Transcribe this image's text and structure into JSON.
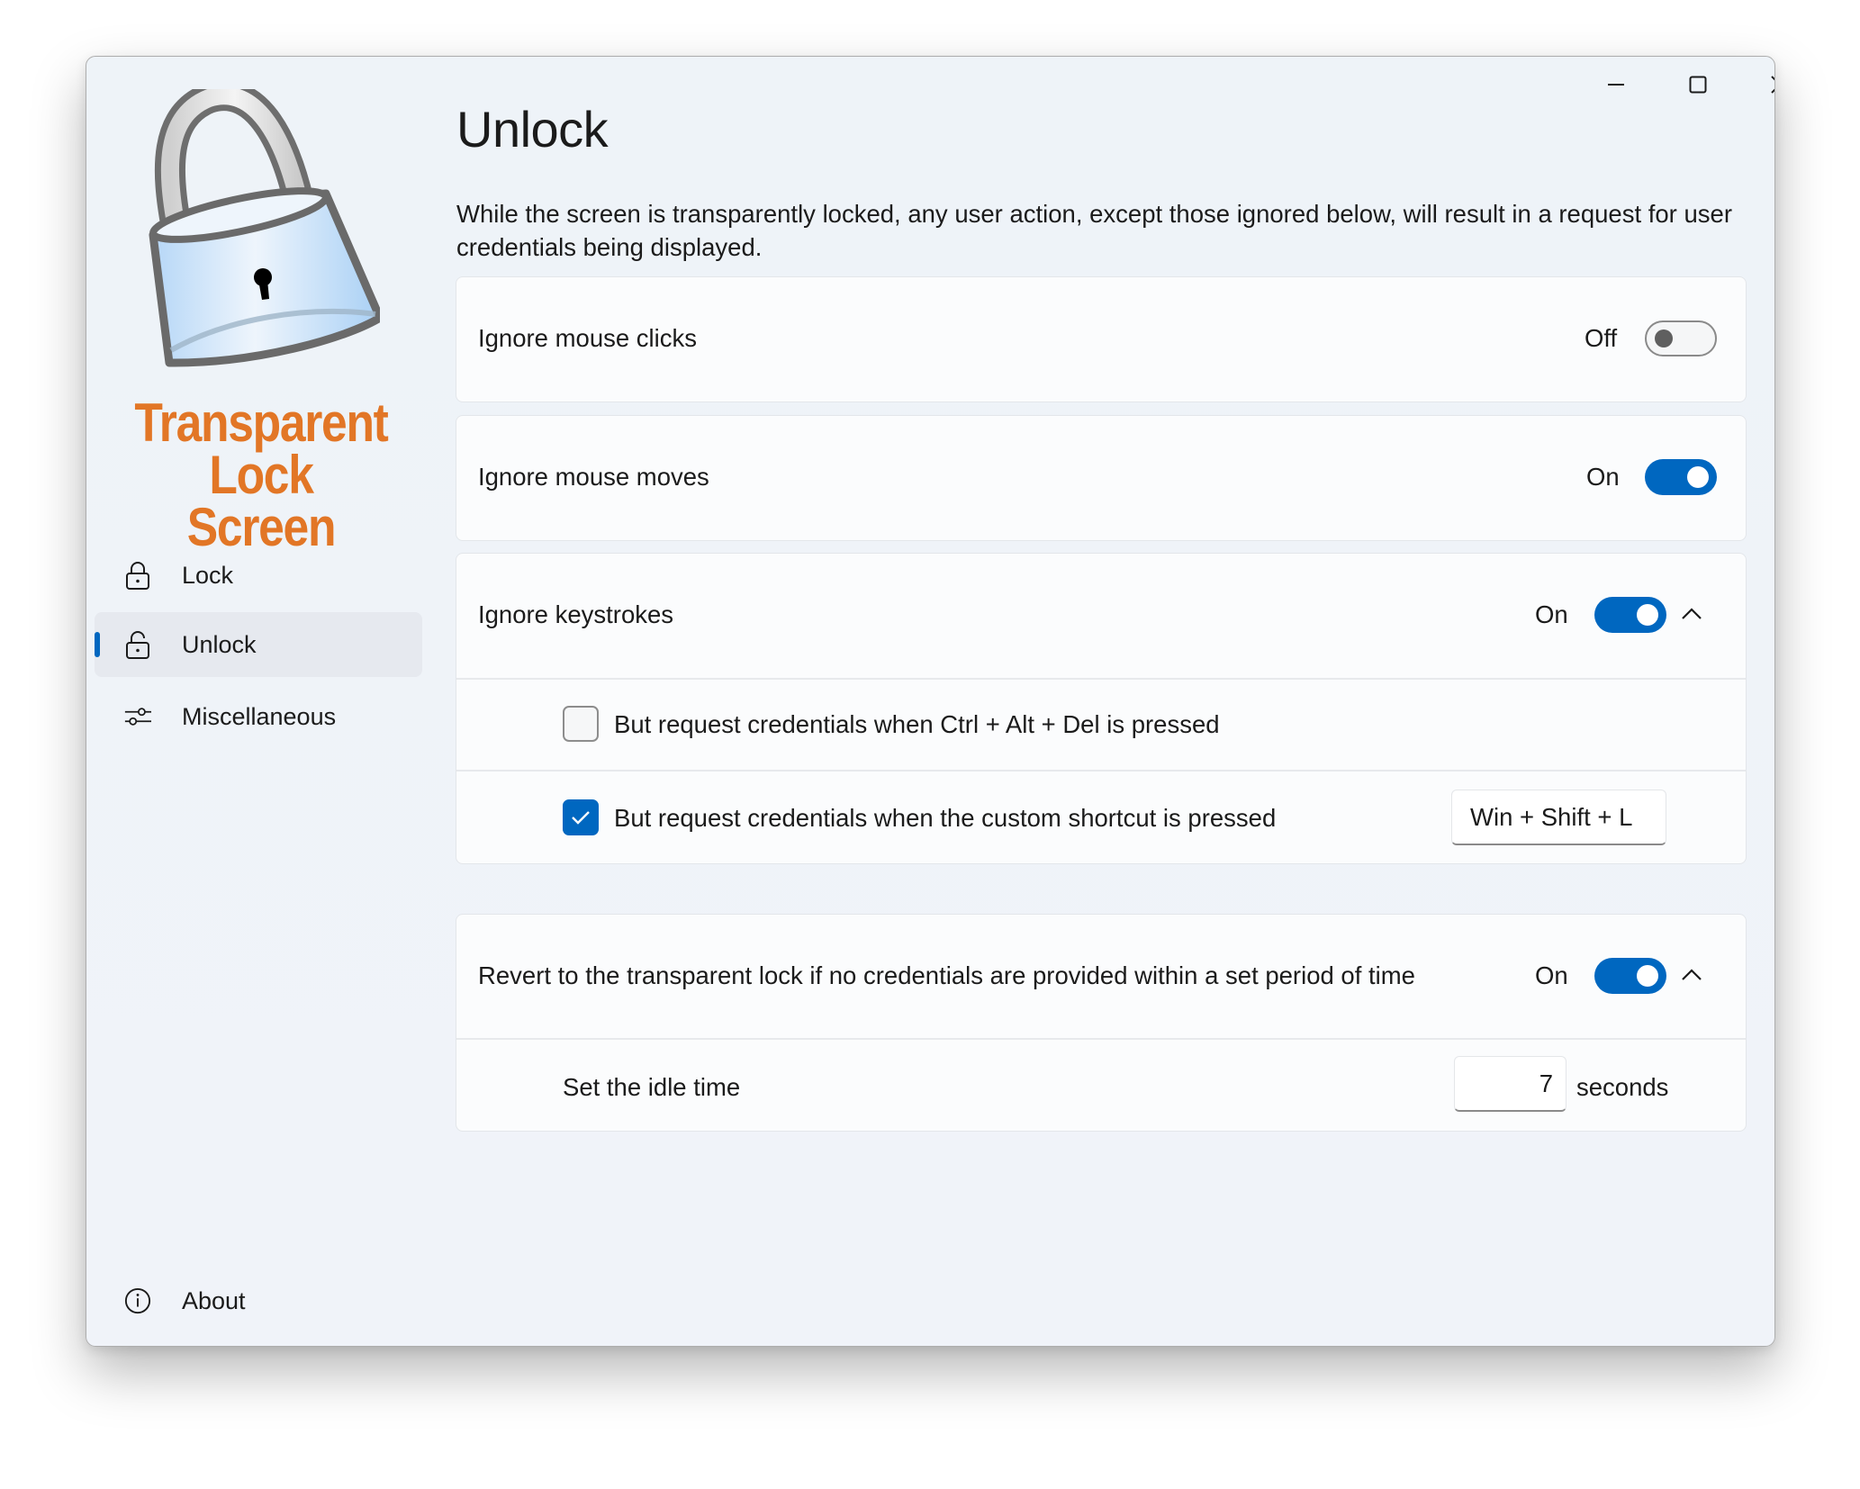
{
  "window": {
    "caption_buttons": [
      {
        "name": "minimize",
        "icon": "minimize-icon"
      },
      {
        "name": "maximize",
        "icon": "maximize-icon"
      },
      {
        "name": "close",
        "icon": "close-icon"
      }
    ]
  },
  "app": {
    "logo_line1": "Transparent",
    "logo_line2": "Lock Screen",
    "logo_icon": "padlock-icon",
    "brand_color": "#e27626"
  },
  "sidebar": {
    "items": [
      {
        "label": "Lock",
        "icon": "lock-icon",
        "selected": false
      },
      {
        "label": "Unlock",
        "icon": "unlock-icon",
        "selected": true
      },
      {
        "label": "Miscellaneous",
        "icon": "sliders-icon",
        "selected": false
      }
    ],
    "footer": {
      "label": "About",
      "icon": "info-icon"
    }
  },
  "page": {
    "title": "Unlock",
    "description": "While the screen is transparently locked, any user action, except those ignored below, will result in a request for user credentials being displayed.",
    "accent_color": "#0067c0",
    "settings": {
      "mouse_clicks": {
        "label": "Ignore mouse clicks",
        "state_text": "Off",
        "on": false
      },
      "mouse_moves": {
        "label": "Ignore mouse moves",
        "state_text": "On",
        "on": true
      },
      "keystrokes": {
        "label": "Ignore keystrokes",
        "state_text": "On",
        "on": true,
        "expanded": true,
        "options": [
          {
            "label": "But request credentials when Ctrl + Alt + Del is pressed",
            "checked": false
          },
          {
            "label": "But request credentials when the custom shortcut is pressed",
            "checked": true,
            "shortcut": "Win + Shift + L"
          }
        ]
      },
      "revert": {
        "label": "Revert to the transparent lock if no credentials are provided within a set period of time",
        "state_text": "On",
        "on": true,
        "expanded": true,
        "idle_label": "Set the idle time",
        "idle_value": "7",
        "idle_unit": "seconds"
      }
    }
  }
}
